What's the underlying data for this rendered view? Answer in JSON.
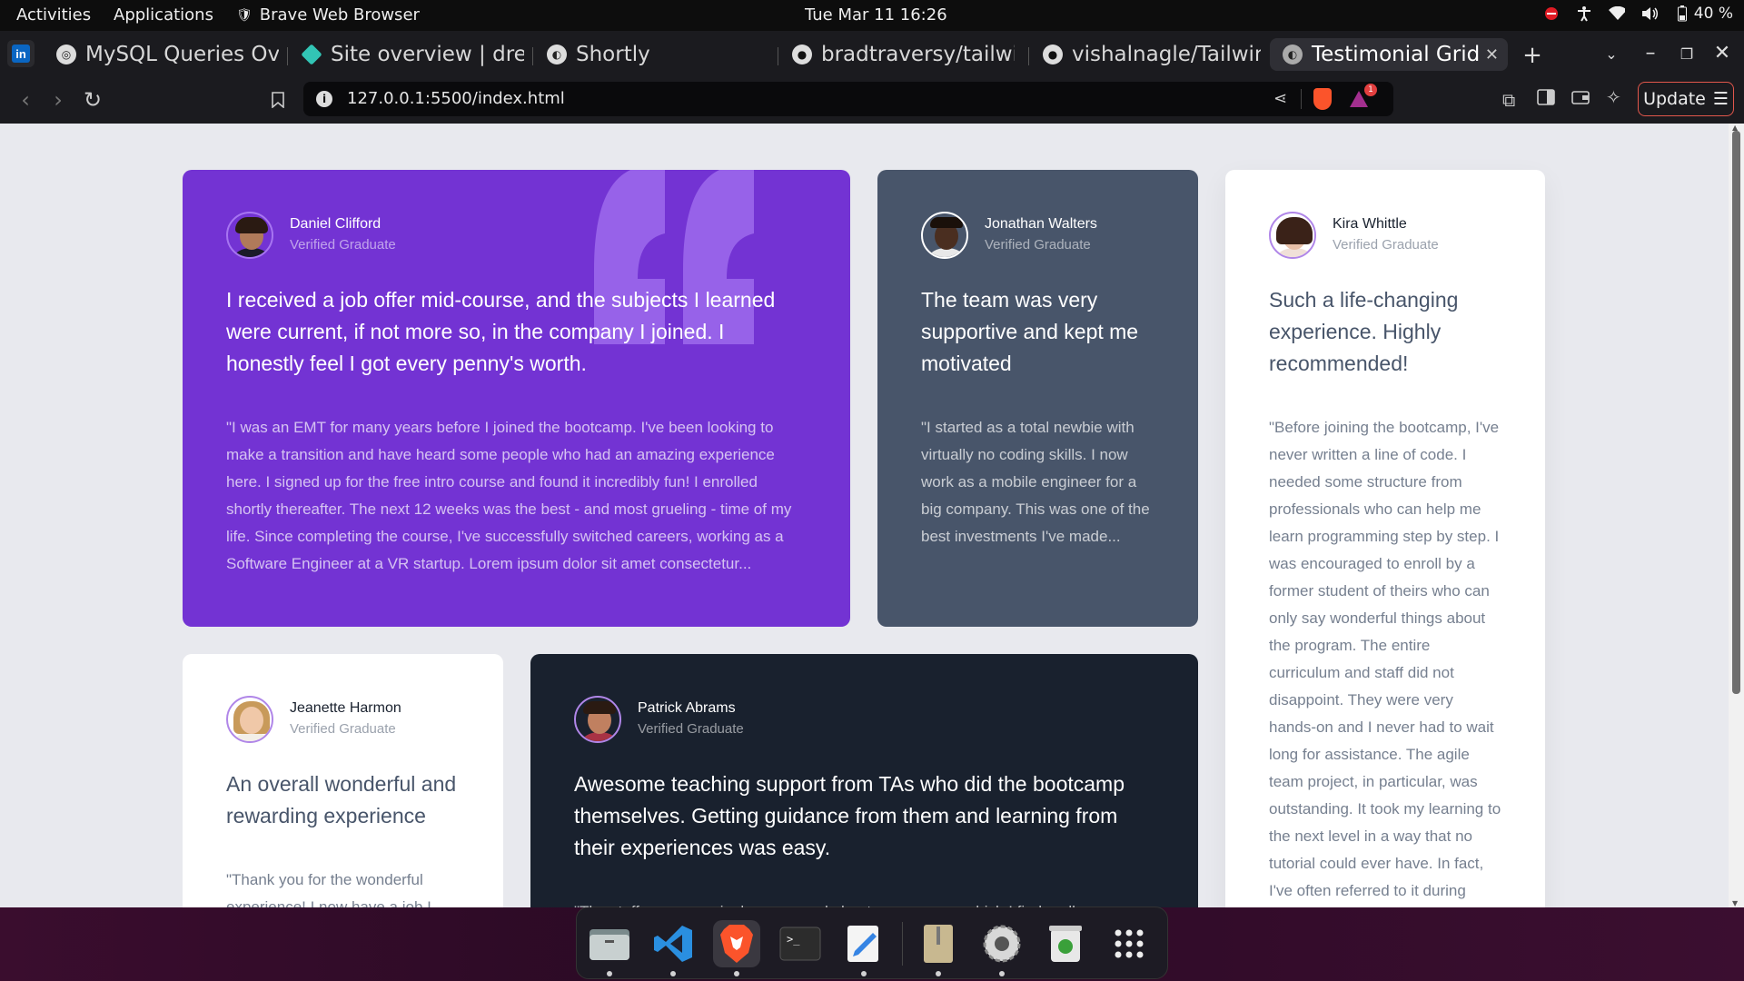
{
  "system": {
    "activities": "Activities",
    "applications": "Applications",
    "app_name": "Brave Web Browser",
    "clock": "Tue Mar 11  16:26",
    "battery": "40 %"
  },
  "tabs": [
    {
      "label": "MySQL Queries Ov",
      "icon": "mysql-icon"
    },
    {
      "label": "Site overview | dre",
      "icon": "netlify-icon"
    },
    {
      "label": "Shortly",
      "icon": "globe-icon"
    },
    {
      "label": "bradtraversy/tailwi",
      "icon": "github-icon"
    },
    {
      "label": "vishalnagle/Tailwin",
      "icon": "github-icon"
    },
    {
      "label": "Testimonial Grid",
      "icon": "globe-icon",
      "active": true
    }
  ],
  "toolbar": {
    "url": "127.0.0.1:5500/index.html",
    "update_label": "Update",
    "shield_badge": "1"
  },
  "testimonials": [
    {
      "name": "Daniel Clifford",
      "status": "Verified Graduate",
      "quote": "I received a job offer mid-course, and the subjects I learned were current, if not more so, in the company I joined. I honestly feel I got every penny's worth.",
      "text": "\"I was an EMT for many years before I joined the bootcamp. I've been looking to make a transition and have heard some people who had an amazing experience here. I signed up for the free intro course and found it incredibly fun! I enrolled shortly thereafter. The next 12 weeks was the best - and most grueling - time of my life. Since completing the course, I've successfully switched careers, working as a Software Engineer at a VR startup. Lorem ipsum dolor sit amet consectetur...",
      "bg": "#7333d3"
    },
    {
      "name": "Jonathan Walters",
      "status": "Verified Graduate",
      "quote": "The team was very supportive and kept me motivated",
      "text": "\"I started as a total newbie with virtually no coding skills. I now work as a mobile engineer for a big company. This was one of the best investments I've made...",
      "bg": "#48556a"
    },
    {
      "name": "Kira Whittle",
      "status": "Verified Graduate",
      "quote": "Such a life-changing experience. Highly recommended!",
      "text": "\"Before joining the bootcamp, I've never written a line of code. I needed some structure from professionals who can help me learn programming step by step. I was encouraged to enroll by a former student of theirs who can only say wonderful things about the program. The entire curriculum and staff did not disappoint. They were very hands-on and I never had to wait long for assistance. The agile team project, in particular, was outstanding. It took my learning to the next level in a way that no tutorial could ever have. In fact, I've often referred to it during",
      "bg": "#ffffff"
    },
    {
      "name": "Jeanette Harmon",
      "status": "Verified Graduate",
      "quote": "An overall wonderful and rewarding experience",
      "text": "\"Thank you for the wonderful experience! I now have a job I",
      "bg": "#ffffff"
    },
    {
      "name": "Patrick Abrams",
      "status": "Verified Graduate",
      "quote": "Awesome teaching support from TAs who did the bootcamp themselves. Getting guidance from them and learning from their experiences was easy.",
      "text": "\"The staff seem genuinely concerned about my progress which I find really",
      "bg": "#19212e"
    }
  ],
  "dock": [
    "files-icon",
    "vscode-icon",
    "brave-icon",
    "terminal-icon",
    "text-editor-icon",
    "archive-icon",
    "settings-icon",
    "trash-icon",
    "app-grid-icon"
  ]
}
